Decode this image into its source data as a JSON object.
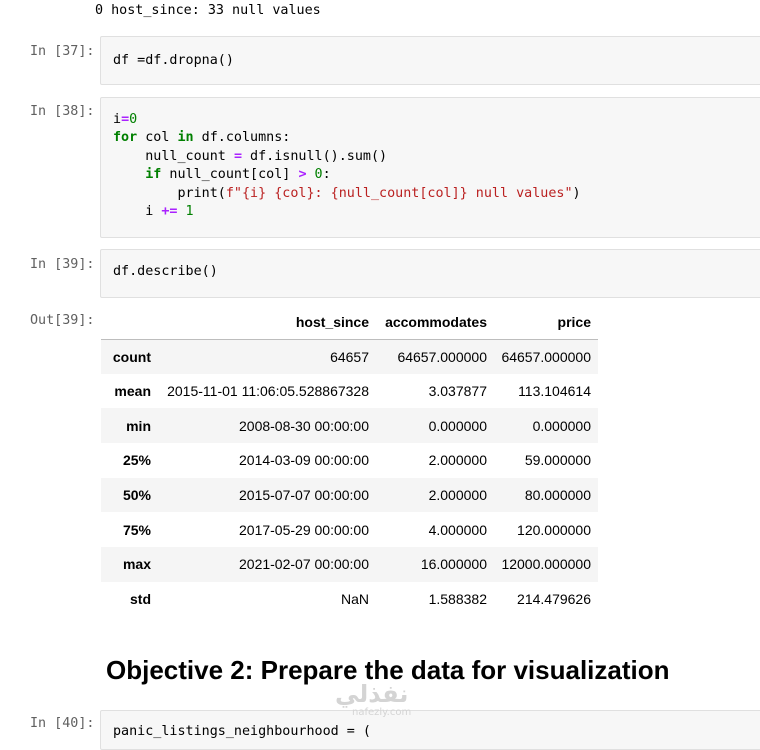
{
  "top_output": "0 host_since: 33 null values",
  "cells": {
    "c37": {
      "prompt": "In [37]:",
      "code": "df =df.dropna()"
    },
    "c38": {
      "prompt": "In [38]:",
      "l1_var": "i",
      "l1_op": "=",
      "l1_num": "0",
      "l2_kw": "for",
      "l2_var": " col ",
      "l2_in": "in",
      "l2_rest": " df.columns:",
      "l3_pre": "    null_count ",
      "l3_op": "=",
      "l3_rest": " df.isnull().sum()",
      "l4_kw": "    if",
      "l4_rest": " null_count[col] ",
      "l4_op": ">",
      "l4_num": " 0",
      "l4_end": ":",
      "l5_pre": "        print(",
      "l5_str": "f\"{i} {col}: {null_count[col]} null values\"",
      "l5_end": ")",
      "l6_pre": "    i ",
      "l6_op": "+=",
      "l6_num": " 1"
    },
    "c39": {
      "prompt": "In [39]:",
      "code": "df.describe()",
      "out_prompt": "Out[39]:"
    },
    "c40": {
      "prompt": "In [40]:",
      "code": "panic_listings_neighbourhood = ("
    }
  },
  "table": {
    "columns": [
      "host_since",
      "accommodates",
      "price"
    ],
    "rows": [
      {
        "label": "count",
        "values": [
          "64657",
          "64657.000000",
          "64657.000000"
        ]
      },
      {
        "label": "mean",
        "values": [
          "2015-11-01 11:06:05.528867328",
          "3.037877",
          "113.104614"
        ]
      },
      {
        "label": "min",
        "values": [
          "2008-08-30 00:00:00",
          "0.000000",
          "0.000000"
        ]
      },
      {
        "label": "25%",
        "values": [
          "2014-03-09 00:00:00",
          "2.000000",
          "59.000000"
        ]
      },
      {
        "label": "50%",
        "values": [
          "2015-07-07 00:00:00",
          "2.000000",
          "80.000000"
        ]
      },
      {
        "label": "75%",
        "values": [
          "2017-05-29 00:00:00",
          "4.000000",
          "120.000000"
        ]
      },
      {
        "label": "max",
        "values": [
          "2021-02-07 00:00:00",
          "16.000000",
          "12000.000000"
        ]
      },
      {
        "label": "std",
        "values": [
          "NaN",
          "1.588382",
          "214.479626"
        ]
      }
    ]
  },
  "heading": "Objective 2: Prepare the data for visualization",
  "watermark": {
    "text": "نفذلي",
    "sub": "nafezly.com"
  }
}
